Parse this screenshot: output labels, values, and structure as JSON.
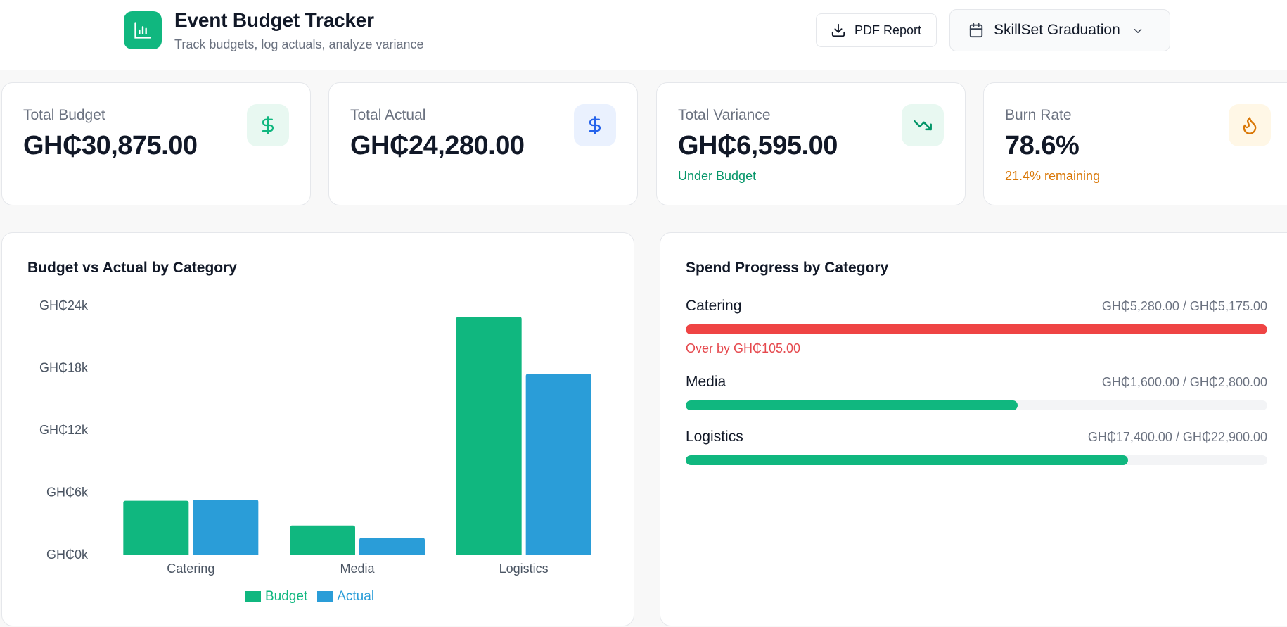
{
  "header": {
    "title": "Event Budget Tracker",
    "subtitle": "Track budgets, log actuals, analyze variance",
    "pdf_button": "PDF Report",
    "event_select": "SkillSet Graduation"
  },
  "stats": [
    {
      "label": "Total Budget",
      "value": "GH₵30,875.00",
      "sub": "",
      "icon": "dollar-icon",
      "icon_color": "#10b77f",
      "icon_bg": "#e8f8f1"
    },
    {
      "label": "Total Actual",
      "value": "GH₵24,280.00",
      "sub": "",
      "icon": "dollar-icon",
      "icon_color": "#2563eb",
      "icon_bg": "#eaf1fe"
    },
    {
      "label": "Total Variance",
      "value": "GH₵6,595.00",
      "sub": "Under Budget",
      "sub_color": "#059669",
      "icon": "trending-down-icon",
      "icon_color": "#059669",
      "icon_bg": "#e8f8f1"
    },
    {
      "label": "Burn Rate",
      "value": "78.6%",
      "sub": "21.4% remaining",
      "sub_color": "#d97706",
      "icon": "flame-icon",
      "icon_color": "#d97706",
      "icon_bg": "#fff7e6"
    }
  ],
  "bar_panel": {
    "title": "Budget vs Actual by Category"
  },
  "chart_data": {
    "type": "bar",
    "title": "Budget vs Actual by Category",
    "categories": [
      "Catering",
      "Media",
      "Logistics"
    ],
    "series": [
      {
        "name": "Budget",
        "values": [
          5175,
          2800,
          22900
        ],
        "color": "#10b77f"
      },
      {
        "name": "Actual",
        "values": [
          5280,
          1600,
          17400
        ],
        "color": "#2a9dd8"
      }
    ],
    "ylim": [
      0,
      24000
    ],
    "yticks": [
      0,
      6000,
      12000,
      18000,
      24000
    ],
    "ytick_labels": [
      "GH₵0k",
      "GH₵6k",
      "GH₵12k",
      "GH₵18k",
      "GH₵24k"
    ],
    "legend": "bottom",
    "grid": false
  },
  "progress_panel": {
    "title": "Spend Progress by Category",
    "items": [
      {
        "name": "Catering",
        "amount": "GH₵5,280.00 / GH₵5,175.00",
        "fraction": 1.0,
        "color": "#ef4444",
        "note": "Over by GH₵105.00"
      },
      {
        "name": "Media",
        "amount": "GH₵1,600.00 / GH₵2,800.00",
        "fraction": 0.571,
        "color": "#10b77f",
        "note": ""
      },
      {
        "name": "Logistics",
        "amount": "GH₵17,400.00 / GH₵22,900.00",
        "fraction": 0.76,
        "color": "#10b77f",
        "note": ""
      }
    ]
  }
}
